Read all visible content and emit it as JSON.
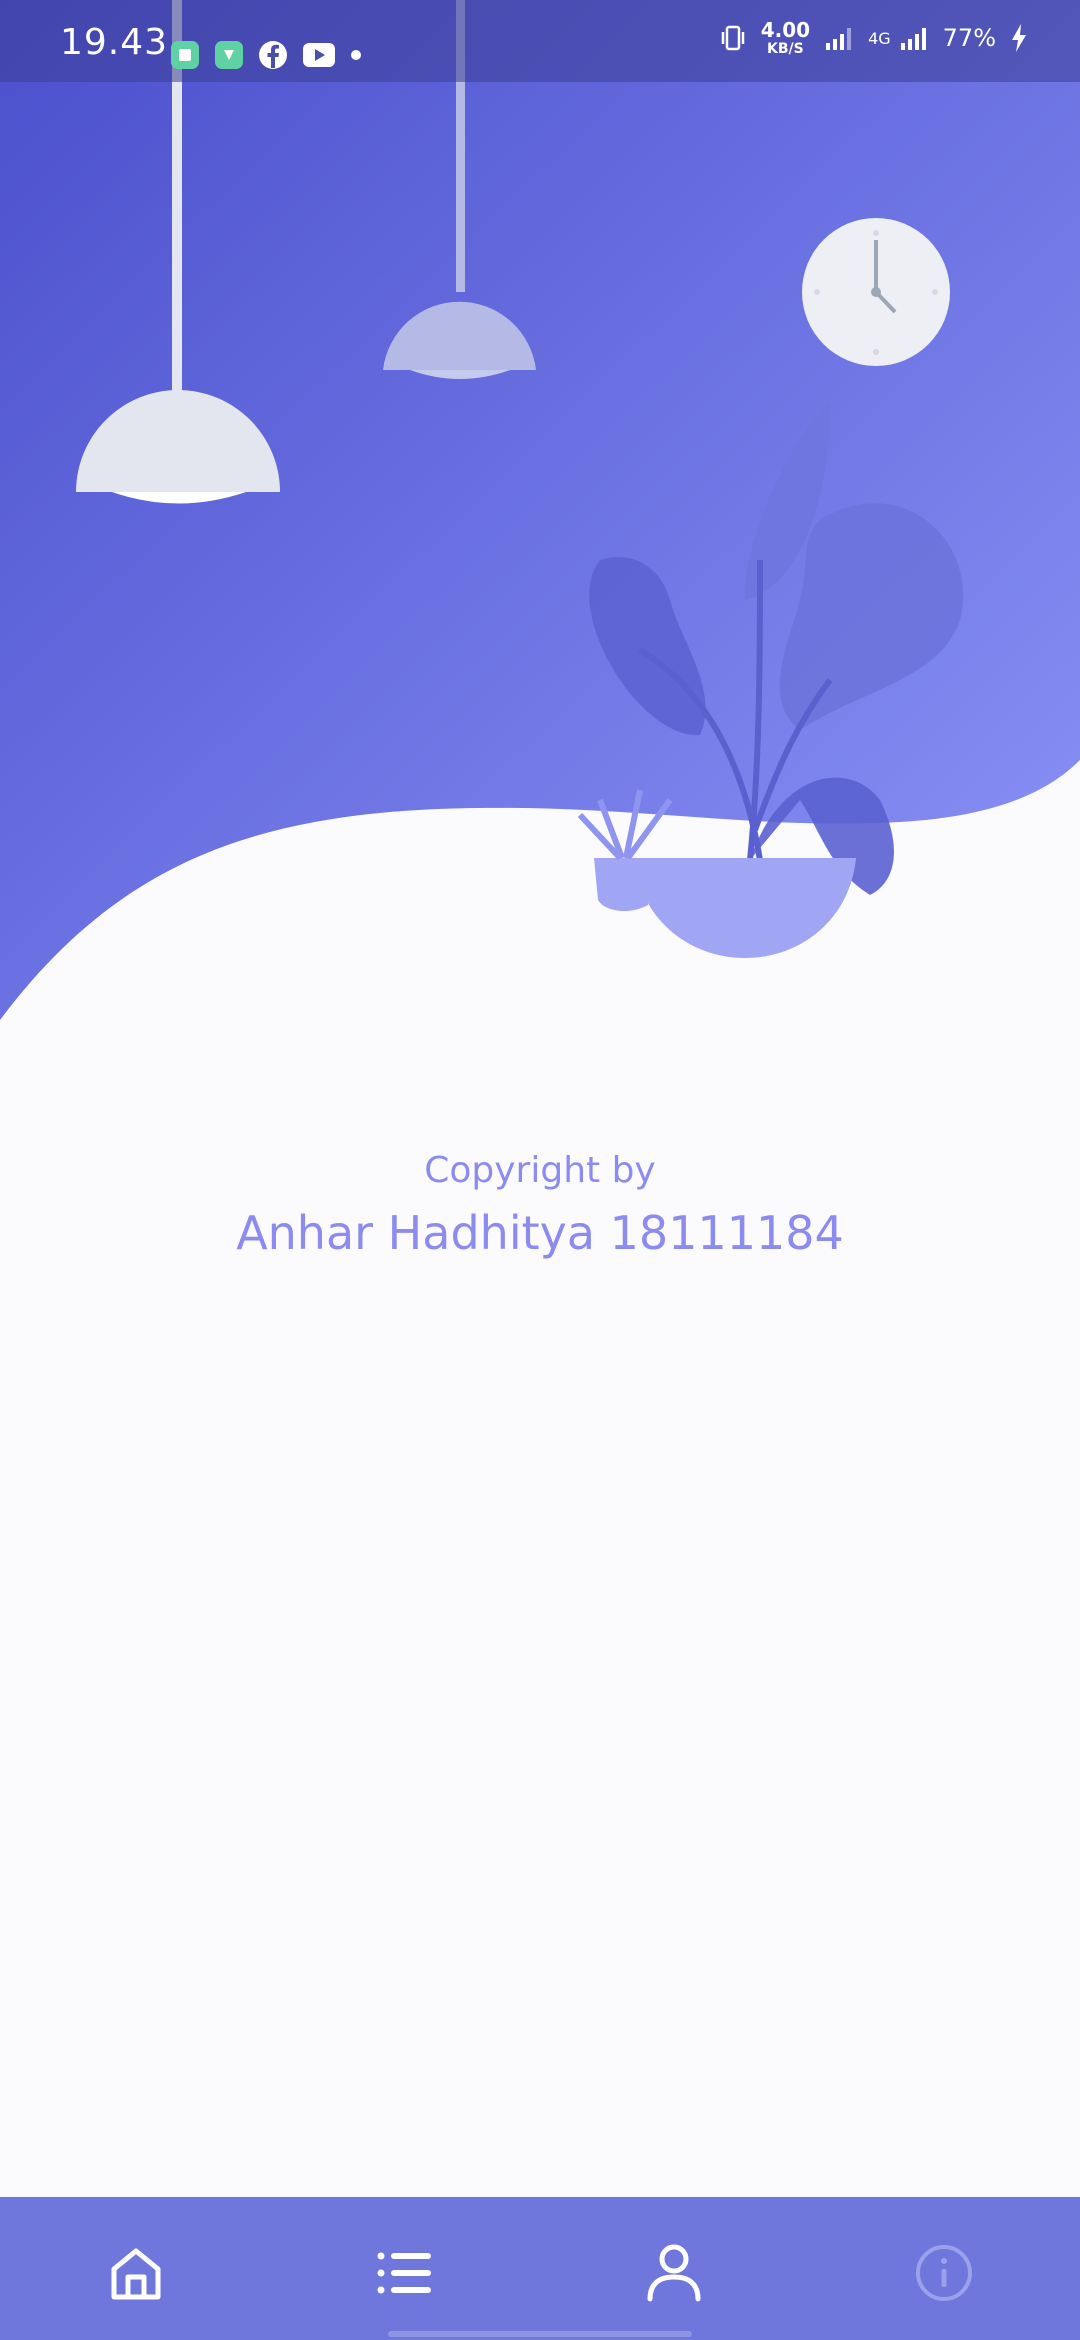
{
  "status_bar": {
    "time": "19.43",
    "net_speed_value": "4.00",
    "net_speed_unit": "KB/S",
    "network_type": "4G",
    "battery": "77%"
  },
  "credits": {
    "line1": "Copyright by",
    "line2": "Anhar Hadhitya 18111184"
  },
  "bottom_nav": {
    "items": [
      {
        "icon": "home-icon"
      },
      {
        "icon": "list-icon"
      },
      {
        "icon": "user-icon"
      },
      {
        "icon": "info-icon"
      }
    ]
  },
  "colors": {
    "hero_gradient_start": "#4a4fcc",
    "hero_gradient_end": "#8d95f8",
    "credit_text": "#8c8cf0",
    "nav_background": "#6f77dc",
    "page_background": "#fbfbfe"
  }
}
